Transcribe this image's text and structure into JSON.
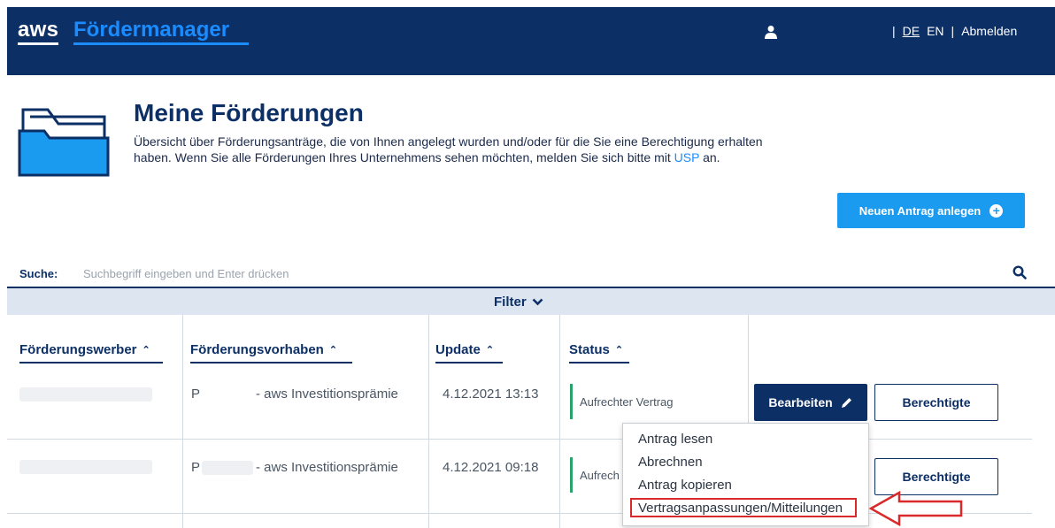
{
  "header": {
    "logo_aws": "aws",
    "logo_product": "Fördermanager",
    "user_icon": "user-icon",
    "separator": "|",
    "lang_de": "DE",
    "lang_en": "EN",
    "logout": "Abmelden"
  },
  "intro": {
    "title": "Meine Förderungen",
    "description_before": "Übersicht über Förderungsanträge, die von Ihnen angelegt wurden und/oder für die Sie eine Berechtigung erhalten haben. Wenn Sie alle Förderungen Ihres Unternehmens sehen möchten, melden Sie sich bitte mit ",
    "description_link": "USP",
    "description_after": " an.",
    "new_button": "Neuen Antrag anlegen"
  },
  "search": {
    "label": "Suche:",
    "placeholder": "Suchbegriff eingeben und Enter drücken"
  },
  "filter": {
    "label": "Filter"
  },
  "table": {
    "columns": [
      "Förderungswerber",
      "Förderungsvorhaben",
      "Update",
      "Status"
    ],
    "rows": [
      {
        "vorhaben_prefix": "P",
        "vorhaben_suffix": "- aws Investitionsprämie",
        "update": "4.12.2021 13:13",
        "status": "Aufrechter Vertrag",
        "edit_button": "Bearbeiten",
        "perm_button": "Berechtigte"
      },
      {
        "vorhaben_prefix": "P",
        "vorhaben_suffix": "- aws Investitionsprämie",
        "update": "4.12.2021 09:18",
        "status": "Aufrech",
        "perm_button": "Berechtigte"
      }
    ]
  },
  "menu": {
    "items": [
      "Antrag lesen",
      "Abrechnen",
      "Antrag kopieren",
      "Vertragsanpassungen/Mitteilungen"
    ],
    "highlighted_index": 3
  },
  "colors": {
    "header_bg": "#0c2f66",
    "accent": "#1a9bf0",
    "status_ok": "#2aa36b",
    "highlight": "#d9292b"
  }
}
